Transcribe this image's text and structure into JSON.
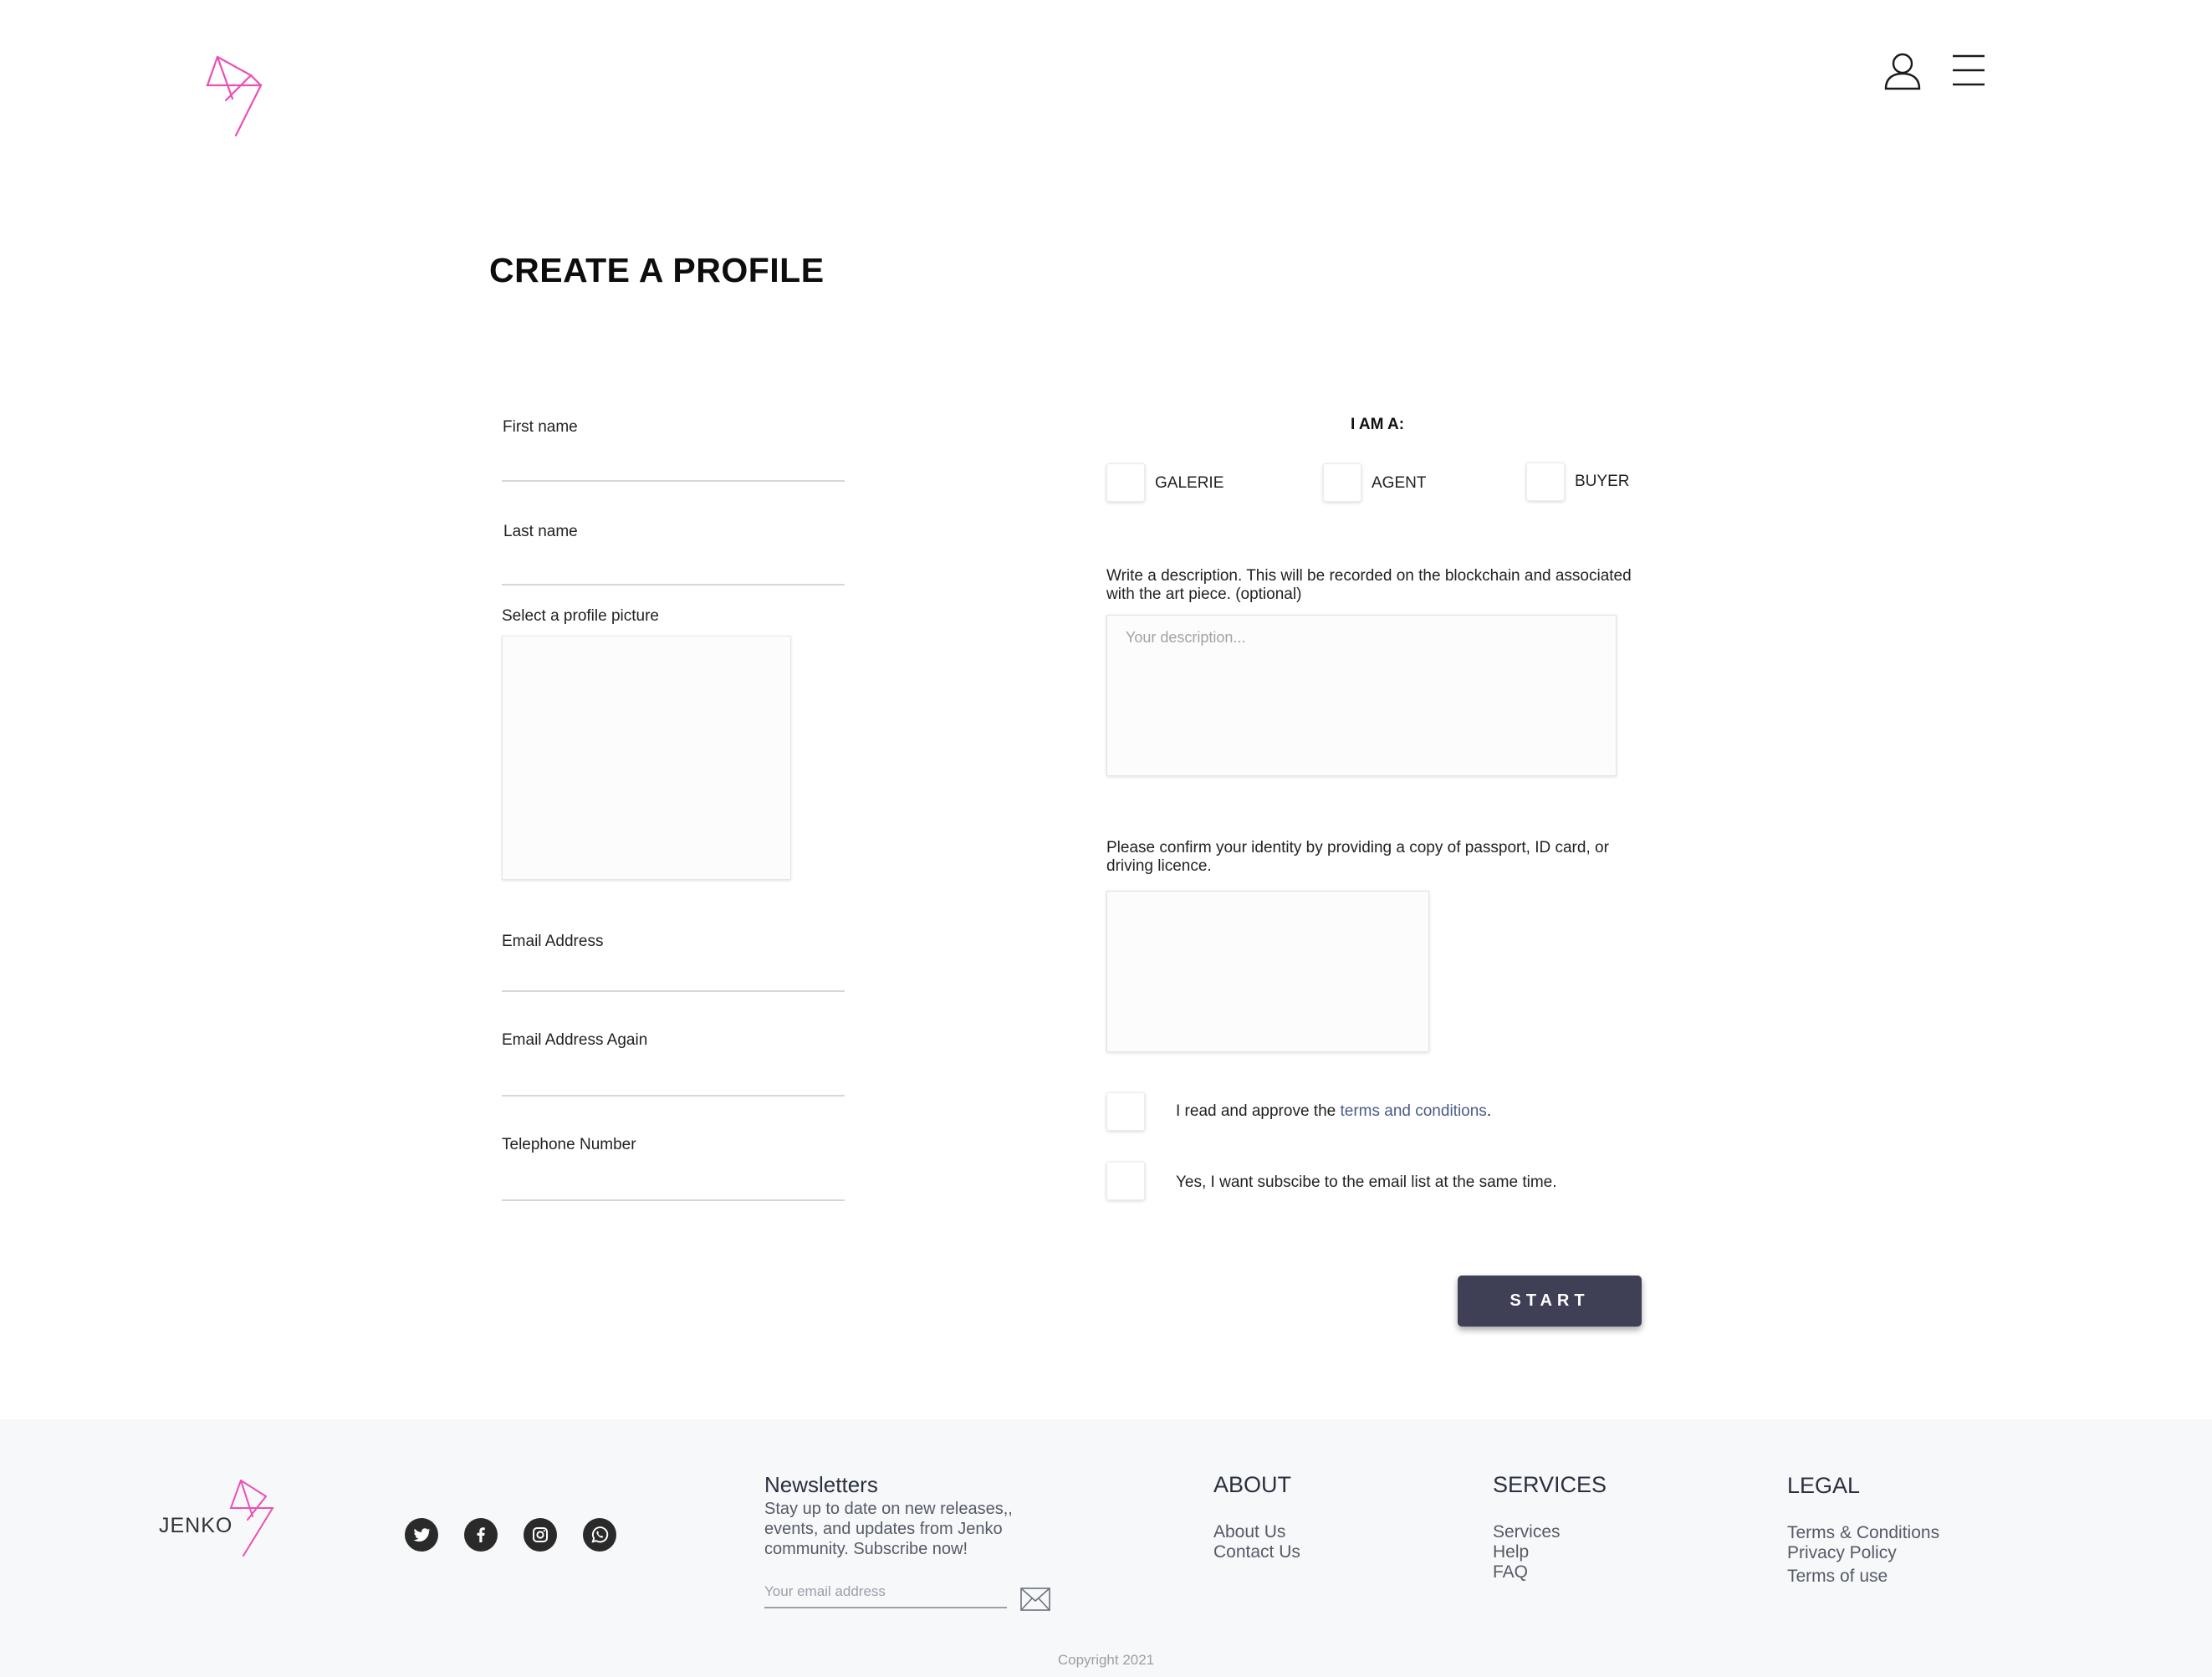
{
  "header": {
    "logo_icon": "jenko-logo-icon",
    "user_icon": "user-icon",
    "menu_icon": "hamburger-menu-icon"
  },
  "page_title": "CREATE A PROFILE",
  "left_form": {
    "first_name_label": "First name",
    "last_name_label": "Last name",
    "profile_picture_label": "Select a profile picture",
    "email_label": "Email Address",
    "email_again_label": "Email Address Again",
    "telephone_label": "Telephone Number"
  },
  "role": {
    "label": "I AM A:",
    "options": [
      "GALERIE",
      "AGENT",
      "BUYER"
    ]
  },
  "description": {
    "label": "Write a description. This will be recorded on the blockchain and associated with the art piece. (optional)",
    "placeholder": "Your description..."
  },
  "identity": {
    "label": "Please confirm your identity by providing a copy of passport, ID card, or driving licence."
  },
  "agreements": {
    "terms_prefix": "I read and approve the ",
    "terms_link": "terms and conditions",
    "terms_suffix": ".",
    "subscribe": "Yes, I want subscibe to the email list at the same time."
  },
  "start_button": "START",
  "colors": {
    "accent_pink": "#ec4fb4",
    "button": "#3f3f55",
    "link": "#4b5b8a",
    "footer_bg": "#f6f8f9"
  },
  "footer": {
    "brand": "JENKO",
    "social_icons": [
      "twitter-icon",
      "facebook-icon",
      "instagram-icon",
      "whatsapp-icon"
    ],
    "newsletter": {
      "title": "Newsletters",
      "text": "Stay up to date on new releases,, events, and updates from Jenko community. Subscribe now!",
      "placeholder": "Your email address",
      "submit_icon": "envelope-icon"
    },
    "about": {
      "heading": "ABOUT",
      "links": [
        "About Us",
        "Contact Us"
      ]
    },
    "services": {
      "heading": "SERVICES",
      "links": [
        "Services",
        "Help",
        "FAQ"
      ]
    },
    "legal": {
      "heading": "LEGAL",
      "links": [
        "Terms & Conditions",
        "Privacy Policy",
        "Terms of use"
      ]
    },
    "copyright": "Copyright 2021"
  }
}
